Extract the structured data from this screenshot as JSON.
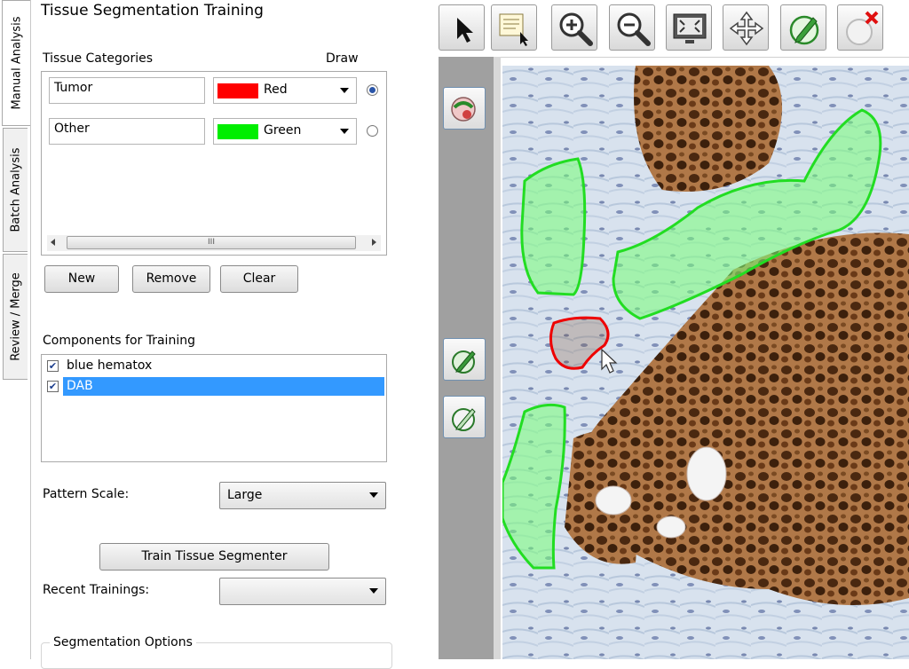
{
  "side_tabs": [
    "Manual Analysis",
    "Batch Analysis",
    "Review / Merge"
  ],
  "panel": {
    "title": "Tissue Segmentation Training",
    "categories_header": "Tissue Categories",
    "draw_header": "Draw",
    "categories": [
      {
        "name": "Tumor",
        "color_name": "Red",
        "color": "#ff0000",
        "selected": true
      },
      {
        "name": "Other",
        "color_name": "Green",
        "color": "#00ee00",
        "selected": false
      }
    ],
    "scrollbar_grip": "III",
    "buttons": {
      "new": "New",
      "remove": "Remove",
      "clear": "Clear"
    },
    "components_label": "Components for Training",
    "components": [
      {
        "name": "blue hematox",
        "checked": true,
        "selected": false
      },
      {
        "name": "DAB",
        "checked": true,
        "selected": true
      }
    ],
    "pattern_scale_label": "Pattern Scale:",
    "pattern_scale_value": "Large",
    "train_button": "Train Tissue Segmenter",
    "recent_trainings_label": "Recent Trainings:",
    "recent_trainings_value": "",
    "segmentation_options_label": "Segmentation Options"
  },
  "toolbar": {
    "icons": [
      "pointer-icon",
      "region-select-icon",
      "zoom-in-icon",
      "zoom-out-icon",
      "fit-to-screen-icon",
      "pan-icon",
      "draw-region-icon",
      "delete-icon"
    ]
  },
  "colors": {
    "accent_selected": "#3399ff",
    "tumor": "#ff0000",
    "other": "#00ee00"
  }
}
